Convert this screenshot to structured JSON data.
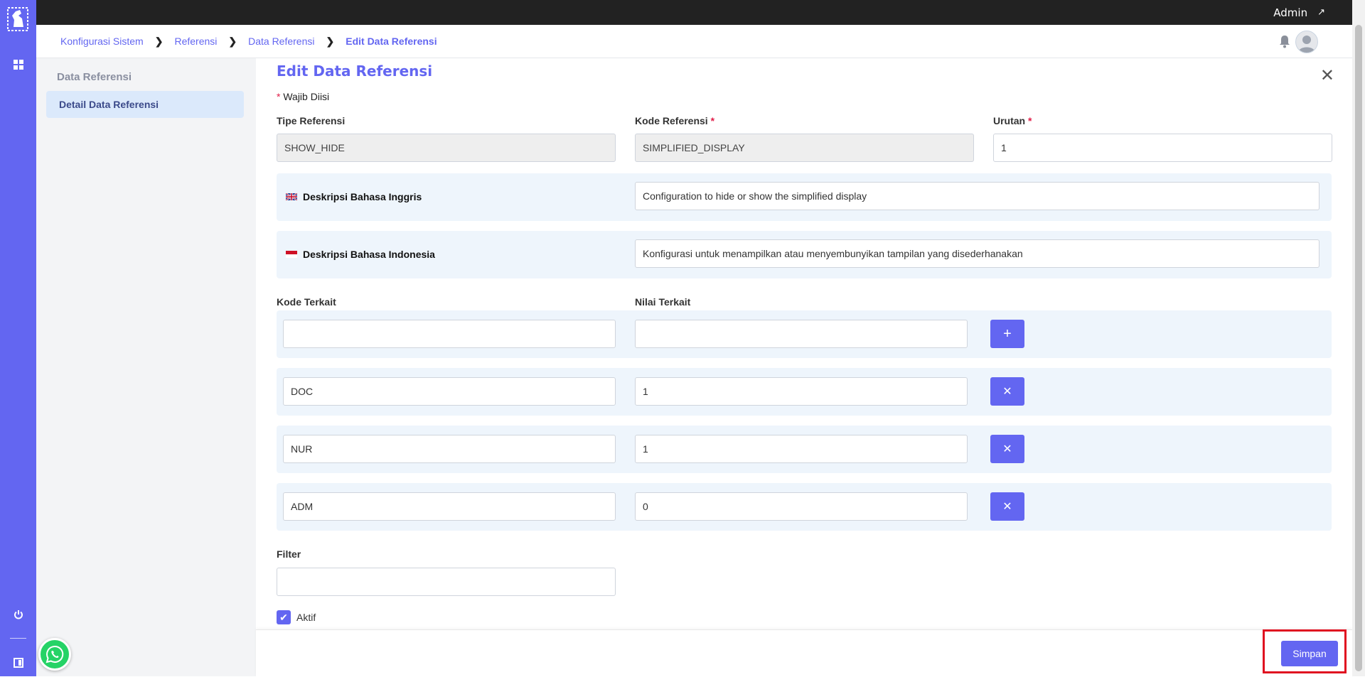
{
  "topbar": {
    "user_label": "Admin"
  },
  "breadcrumb": [
    {
      "label": "Konfigurasi Sistem"
    },
    {
      "label": "Referensi"
    },
    {
      "label": "Data Referensi"
    },
    {
      "label": "Edit Data Referensi"
    }
  ],
  "sidepanel": {
    "title": "Data Referensi",
    "active_item": "Detail Data Referensi"
  },
  "form": {
    "title": "Edit Data Referensi",
    "required_note": "Wajib Diisi",
    "required_marker": "*",
    "tipe_label": "Tipe Referensi",
    "tipe_value": "SHOW_HIDE",
    "kode_label": "Kode Referensi",
    "kode_value": "SIMPLIFIED_DISPLAY",
    "urutan_label": "Urutan",
    "urutan_value": "1",
    "desc_en_label": "Deskripsi Bahasa Inggris",
    "desc_en_value": "Configuration to hide or show the simplified display",
    "desc_id_label": "Deskripsi Bahasa Indonesia",
    "desc_id_value": "Konfigurasi untuk menampilkan atau menyembunyikan tampilan yang disederhanakan",
    "kode_terkait_label": "Kode Terkait",
    "nilai_terkait_label": "Nilai Terkait",
    "new_row": {
      "kode": "",
      "nilai": ""
    },
    "rows": [
      {
        "kode": "DOC",
        "nilai": "1"
      },
      {
        "kode": "NUR",
        "nilai": "1"
      },
      {
        "kode": "ADM",
        "nilai": "0"
      }
    ],
    "filter_label": "Filter",
    "filter_value": "",
    "aktif_label": "Aktif",
    "aktif_checked": true
  },
  "footer": {
    "save_label": "Simpan"
  },
  "colors": {
    "accent": "#6366f1",
    "topbar": "#222222",
    "band": "#eef5fc",
    "highlight": "#e01020"
  }
}
